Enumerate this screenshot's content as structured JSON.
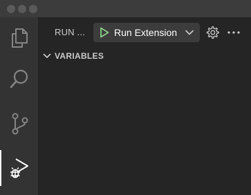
{
  "activity_bar": {
    "items": [
      {
        "icon": "files-icon",
        "active": false
      },
      {
        "icon": "search-icon",
        "active": false
      },
      {
        "icon": "source-control-icon",
        "active": false
      },
      {
        "icon": "run-debug-icon",
        "active": true
      }
    ]
  },
  "sidebar": {
    "title": "RUN ...",
    "run_config": {
      "selected": "Run Extension",
      "play_icon": "play-icon",
      "play_color": "#89d185",
      "dropdown_icon": "chevron-down-icon"
    },
    "actions": {
      "settings_icon": "gear-icon",
      "more_icon": "ellipsis-icon"
    },
    "sections": [
      {
        "title": "VARIABLES",
        "expanded": true
      }
    ]
  },
  "colors": {
    "titlebar": "#3c3c3c",
    "activitybar": "#333333",
    "sidebar": "#252526",
    "select_bg": "#3c3c3c",
    "icon_inactive": "#858585",
    "icon_active": "#ffffff",
    "text": "#cccccc"
  }
}
